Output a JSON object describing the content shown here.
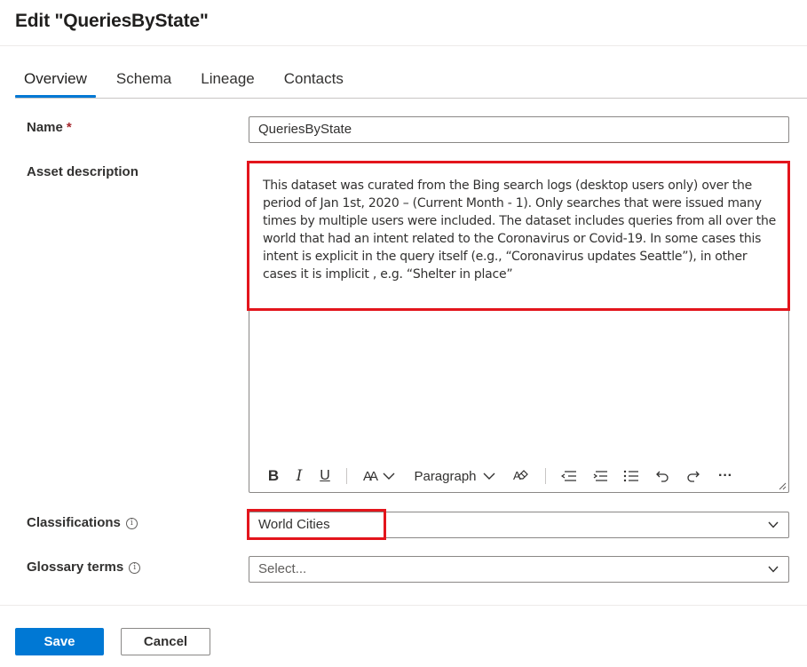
{
  "header": {
    "title": "Edit \"QueriesByState\""
  },
  "tabs": [
    {
      "label": "Overview",
      "active": true
    },
    {
      "label": "Schema",
      "active": false
    },
    {
      "label": "Lineage",
      "active": false
    },
    {
      "label": "Contacts",
      "active": false
    }
  ],
  "form": {
    "name": {
      "label": "Name",
      "required_mark": "*",
      "value": "QueriesByState"
    },
    "description": {
      "label": "Asset description",
      "value": "This dataset was curated from the Bing search logs (desktop users only) over the period of Jan 1st, 2020 – (Current Month - 1). Only searches that were issued many times by multiple users were included. The dataset includes queries from all over the world that had an intent related to the Coronavirus or Covid-19. In some cases this intent is explicit in the query itself (e.g., “Coronavirus updates Seattle”), in other cases it is implicit , e.g. “Shelter in place”"
    },
    "classifications": {
      "label": "Classifications",
      "value": "World Cities"
    },
    "glossary": {
      "label": "Glossary terms",
      "placeholder": "Select..."
    }
  },
  "toolbar": {
    "bold": "B",
    "italic": "I",
    "underline": "U",
    "font_size": "AA",
    "paragraph": "Paragraph",
    "more": "···",
    "icons": [
      "bold-icon",
      "italic-icon",
      "underline-icon",
      "font-size-icon",
      "paragraph-dropdown",
      "clear-format-icon",
      "outdent-icon",
      "indent-icon",
      "bullet-list-icon",
      "undo-icon",
      "redo-icon",
      "more-icon"
    ]
  },
  "footer": {
    "save_label": "Save",
    "cancel_label": "Cancel"
  },
  "colors": {
    "accent": "#0078d4",
    "highlight": "#e3151c",
    "required": "#a4262c"
  }
}
